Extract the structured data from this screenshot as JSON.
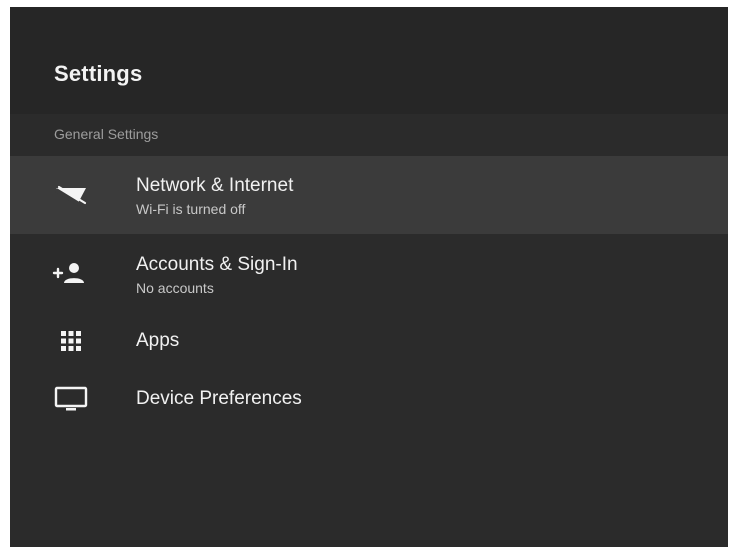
{
  "header": {
    "title": "Settings"
  },
  "section": {
    "label": "General Settings"
  },
  "items": [
    {
      "icon": "wifi-off-icon",
      "title": "Network & Internet",
      "subtitle": "Wi-Fi is turned off",
      "selected": true
    },
    {
      "icon": "add-account-icon",
      "title": "Accounts & Sign-In",
      "subtitle": "No accounts",
      "selected": false
    },
    {
      "icon": "apps-grid-icon",
      "title": "Apps",
      "subtitle": "",
      "selected": false
    },
    {
      "icon": "monitor-icon",
      "title": "Device Preferences",
      "subtitle": "",
      "selected": false
    }
  ],
  "colors": {
    "background": "#2b2b2b",
    "header_background": "#262626",
    "selected_row": "#3b3b3b",
    "text_primary": "#f1f1f1",
    "text_secondary": "#c8c8c8",
    "section_label": "#9d9d9d"
  }
}
